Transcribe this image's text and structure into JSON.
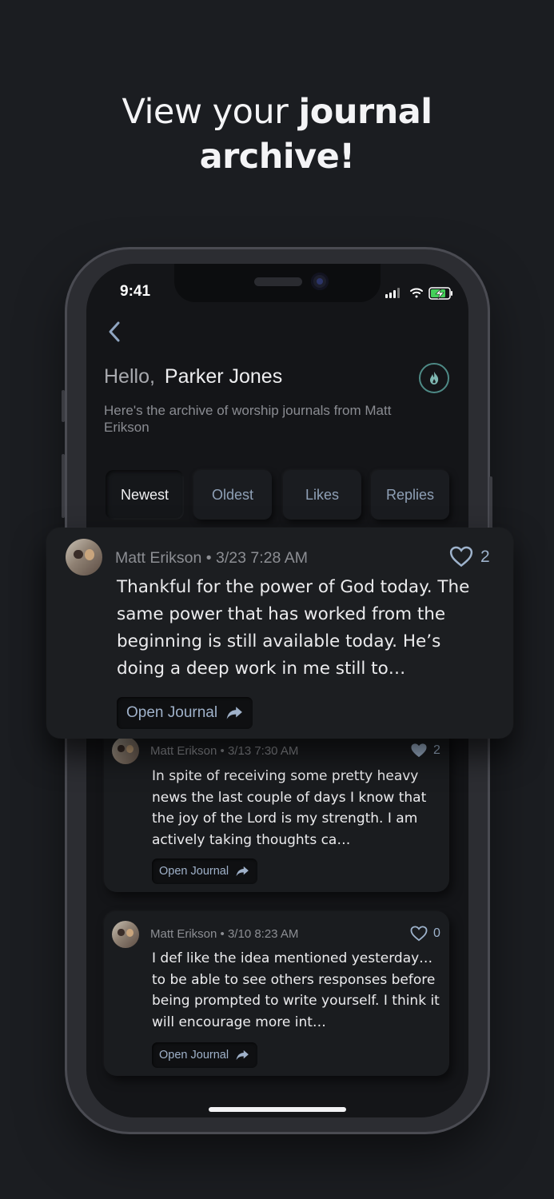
{
  "headline": {
    "light": "View your ",
    "bold1": "journal",
    "bold2": "archive!"
  },
  "status_bar": {
    "time": "9:41"
  },
  "header": {
    "greeting": "Hello,",
    "name": "Parker Jones",
    "subtitle": "Here's the archive of worship journals from Matt Erikson"
  },
  "tabs": [
    "Newest",
    "Oldest",
    "Likes",
    "Replies"
  ],
  "active_tab": "Newest",
  "entries": [
    {
      "author": "Matt Erikson",
      "timestamp": "3/23 7:28 AM",
      "likes": "2",
      "liked": false,
      "text": "Thankful for the power of God today. The same power that has worked from the beginning is still available today. He’s doing a deep work in me still to…",
      "button": "Open Journal"
    },
    {
      "author": "Matt Erikson",
      "timestamp": "3/13 7:30 AM",
      "likes": "2",
      "liked": true,
      "text": "In spite of receiving some pretty heavy news the last couple of days I know that the joy of the Lord is my strength.  I am actively taking thoughts ca…",
      "button": "Open Journal"
    },
    {
      "author": "Matt Erikson",
      "timestamp": "3/10 8:23 AM",
      "likes": "0",
      "liked": false,
      "text": "I def like the idea mentioned yesterday…to be able to see others responses before being prompted to write yourself. I think it will encourage more int…",
      "button": "Open Journal"
    }
  ],
  "separator": "•",
  "colors": {
    "background": "#1b1d21",
    "accent_teal": "#4e8a86",
    "like_blue": "#9eb3cc"
  }
}
